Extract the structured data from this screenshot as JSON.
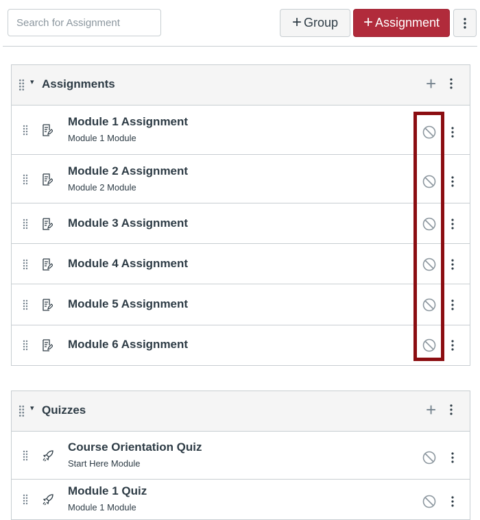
{
  "toolbar": {
    "search_placeholder": "Search for Assignment",
    "group_label": "Group",
    "assignment_label": "Assignment",
    "more_icon": "kebab-icon"
  },
  "groups": [
    {
      "title": "Assignments",
      "items": [
        {
          "title": "Module 1 Assignment",
          "subtitle": "Module 1 Module",
          "icon": "assignment-icon",
          "status": "unpublished-icon"
        },
        {
          "title": "Module 2 Assignment",
          "subtitle": "Module 2 Module",
          "icon": "assignment-icon",
          "status": "unpublished-icon"
        },
        {
          "title": "Module 3 Assignment",
          "subtitle": "",
          "icon": "assignment-icon",
          "status": "unpublished-icon"
        },
        {
          "title": "Module 4 Assignment",
          "subtitle": "",
          "icon": "assignment-icon",
          "status": "unpublished-icon"
        },
        {
          "title": "Module 5 Assignment",
          "subtitle": "",
          "icon": "assignment-icon",
          "status": "unpublished-icon"
        },
        {
          "title": "Module 6 Assignment",
          "subtitle": "",
          "icon": "assignment-icon",
          "status": "unpublished-icon"
        }
      ]
    },
    {
      "title": "Quizzes",
      "items": [
        {
          "title": "Course Orientation Quiz",
          "subtitle": "Start Here Module",
          "icon": "quiz-rocket-icon",
          "status": "unpublished-icon"
        },
        {
          "title": "Module 1 Quiz",
          "subtitle": "Module 1 Module",
          "icon": "quiz-rocket-icon",
          "status": "unpublished-icon"
        }
      ]
    }
  ],
  "colors": {
    "accent": "#b12b3b",
    "highlight_border": "#8b0d11",
    "header_bg": "#f5f5f5",
    "border": "#c7cdd1"
  }
}
